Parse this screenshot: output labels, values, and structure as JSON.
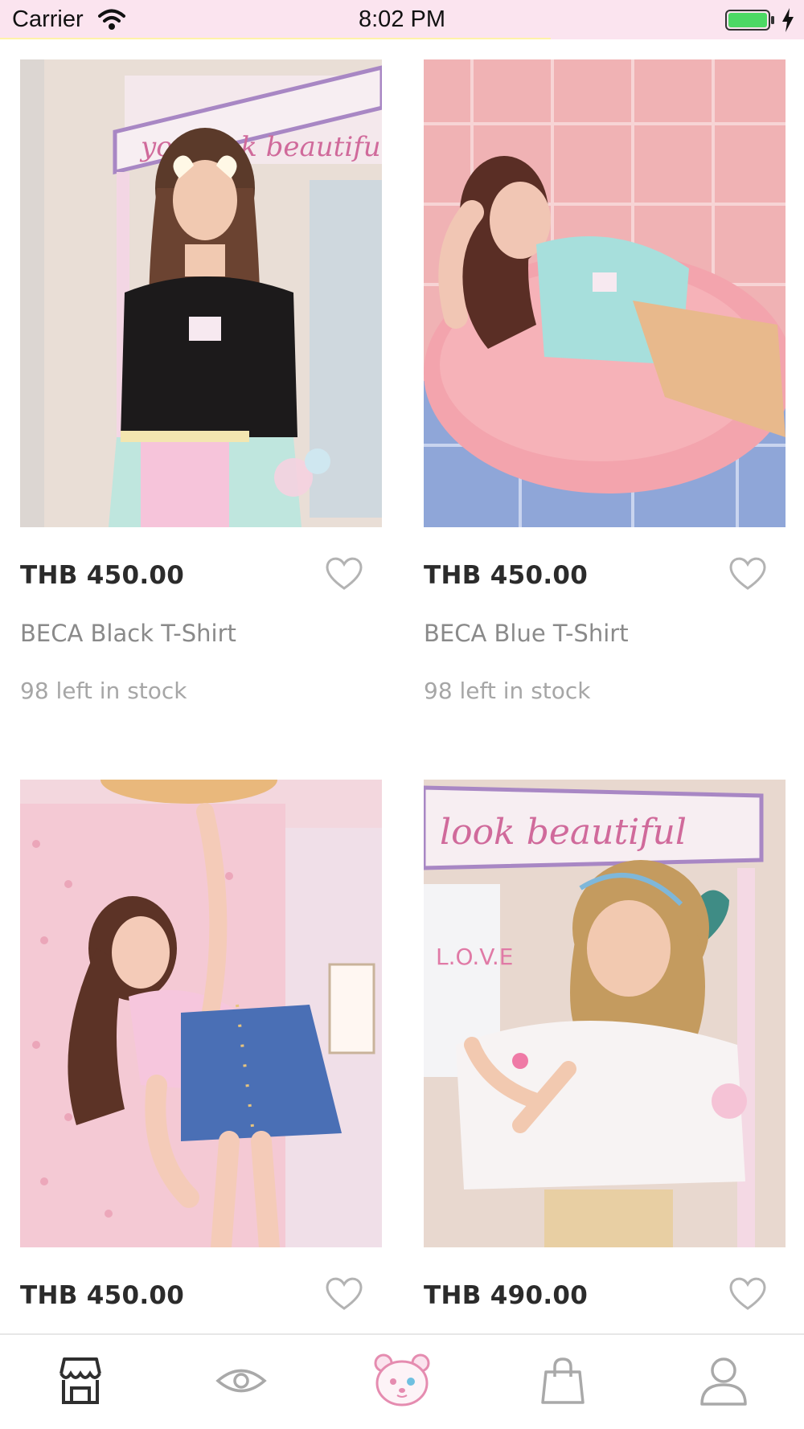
{
  "status_bar": {
    "carrier": "Carrier",
    "time": "8:02 PM",
    "battery_color": "#4cd964",
    "icons": [
      "wifi-icon",
      "battery-icon",
      "charging-bolt-icon"
    ]
  },
  "products": [
    {
      "price": "THB 450.00",
      "name": "BECA Black T-Shirt",
      "stock": "98 left in stock",
      "shirt_color": "#1c1a1b"
    },
    {
      "price": "THB 450.00",
      "name": "BECA Blue T-Shirt",
      "stock": "98 left in stock",
      "shirt_color": "#a7dfdc"
    },
    {
      "price": "THB 450.00",
      "name": "",
      "stock": "",
      "shirt_color": "#f6c6dd"
    },
    {
      "price": "THB 490.00",
      "name": "",
      "stock": "",
      "shirt_color": "#f7f3f3"
    }
  ],
  "tab_bar": {
    "tabs": [
      "shop-icon",
      "eye-icon",
      "bear-mascot-icon",
      "shopping-bag-icon",
      "profile-icon"
    ],
    "active_tab": "shop-icon",
    "active_color": "#2f2f2f",
    "inactive_color": "#a9a9a9"
  }
}
